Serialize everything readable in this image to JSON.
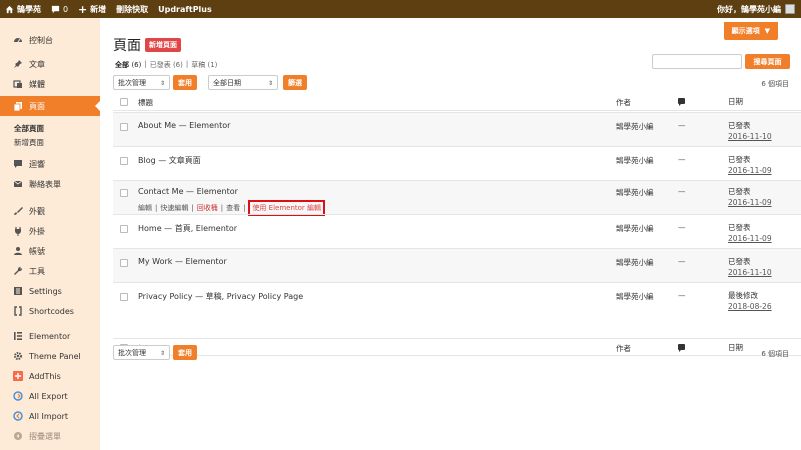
{
  "adminbar": {
    "site_name": "鵠學苑",
    "comments_count": "0",
    "new_label": "新增",
    "cache_label": "刪除快取",
    "updraft_label": "UpdraftPlus",
    "greeting": "你好，鵠學苑小編"
  },
  "sidebar": {
    "items": [
      {
        "label": "控制台",
        "icon": "dashboard-icon"
      },
      {
        "label": "文章",
        "icon": "pin-icon"
      },
      {
        "label": "媒體",
        "icon": "media-icon"
      },
      {
        "label": "頁面",
        "icon": "pages-icon"
      },
      {
        "label": "迴響",
        "icon": "comment-icon"
      },
      {
        "label": "聯絡表單",
        "icon": "mail-icon"
      },
      {
        "label": "外觀",
        "icon": "brush-icon"
      },
      {
        "label": "外掛",
        "icon": "plugin-icon"
      },
      {
        "label": "帳號",
        "icon": "user-icon"
      },
      {
        "label": "工具",
        "icon": "wrench-icon"
      },
      {
        "label": "Settings",
        "icon": "settings-icon"
      },
      {
        "label": "Shortcodes",
        "icon": "shortcode-icon"
      },
      {
        "label": "Elementor",
        "icon": "elementor-icon"
      },
      {
        "label": "Theme Panel",
        "icon": "gear-icon"
      },
      {
        "label": "AddThis",
        "icon": "addthis-icon"
      },
      {
        "label": "All Export",
        "icon": "export-icon"
      },
      {
        "label": "All Import",
        "icon": "import-icon"
      },
      {
        "label": "摺疊選單",
        "icon": "collapse-icon"
      }
    ],
    "submenu": [
      "全部頁面",
      "新增頁面"
    ]
  },
  "header": {
    "screen_options": "顯示選項",
    "title": "頁面",
    "add_new": "新增頁面",
    "views": {
      "all": "全部",
      "all_count": "(6)",
      "published": "已發表",
      "published_count": "(6)",
      "drafts": "草稿",
      "drafts_count": "(1)"
    },
    "search_button": "搜尋頁面",
    "bulk_action": "批次管理",
    "apply": "套用",
    "all_dates": "全部日期",
    "filter": "篩選",
    "items_count": "6 個項目"
  },
  "table": {
    "columns": {
      "title": "標題",
      "author": "作者",
      "date": "日期"
    },
    "rows": [
      {
        "title": "About Me — Elementor",
        "author": "鵠學苑小編",
        "comments": "—",
        "status": "已發表",
        "date": "2016-11-10"
      },
      {
        "title": "Blog — 文章頁面",
        "author": "鵠學苑小編",
        "comments": "—",
        "status": "已發表",
        "date": "2016-11-09"
      },
      {
        "title": "Contact Me — Elementor",
        "author": "鵠學苑小編",
        "comments": "—",
        "status": "已發表",
        "date": "2016-11-09"
      },
      {
        "title": "Home — 首頁, Elementor",
        "author": "鵠學苑小編",
        "comments": "—",
        "status": "已發表",
        "date": "2016-11-09"
      },
      {
        "title": "My Work — Elementor",
        "author": "鵠學苑小編",
        "comments": "—",
        "status": "已發表",
        "date": "2016-11-10"
      },
      {
        "title": "Privacy Policy — 草稿, Privacy Policy Page",
        "author": "鵠學苑小編",
        "comments": "—",
        "status": "最後修改",
        "date": "2018-08-26"
      }
    ],
    "row_actions": {
      "edit": "編輯",
      "quick_edit": "快速編輯",
      "trash": "回收桶",
      "view": "查看",
      "edit_elementor": "使用 Elementor 編輯"
    }
  },
  "footer": {
    "bulk_action": "批次管理",
    "apply": "套用",
    "items_count": "6 個項目"
  },
  "colors": {
    "accent": "#f17f2a",
    "adminbar": "#5e3f12",
    "sidebar": "#fdebd7",
    "highlight": "#e04646"
  }
}
